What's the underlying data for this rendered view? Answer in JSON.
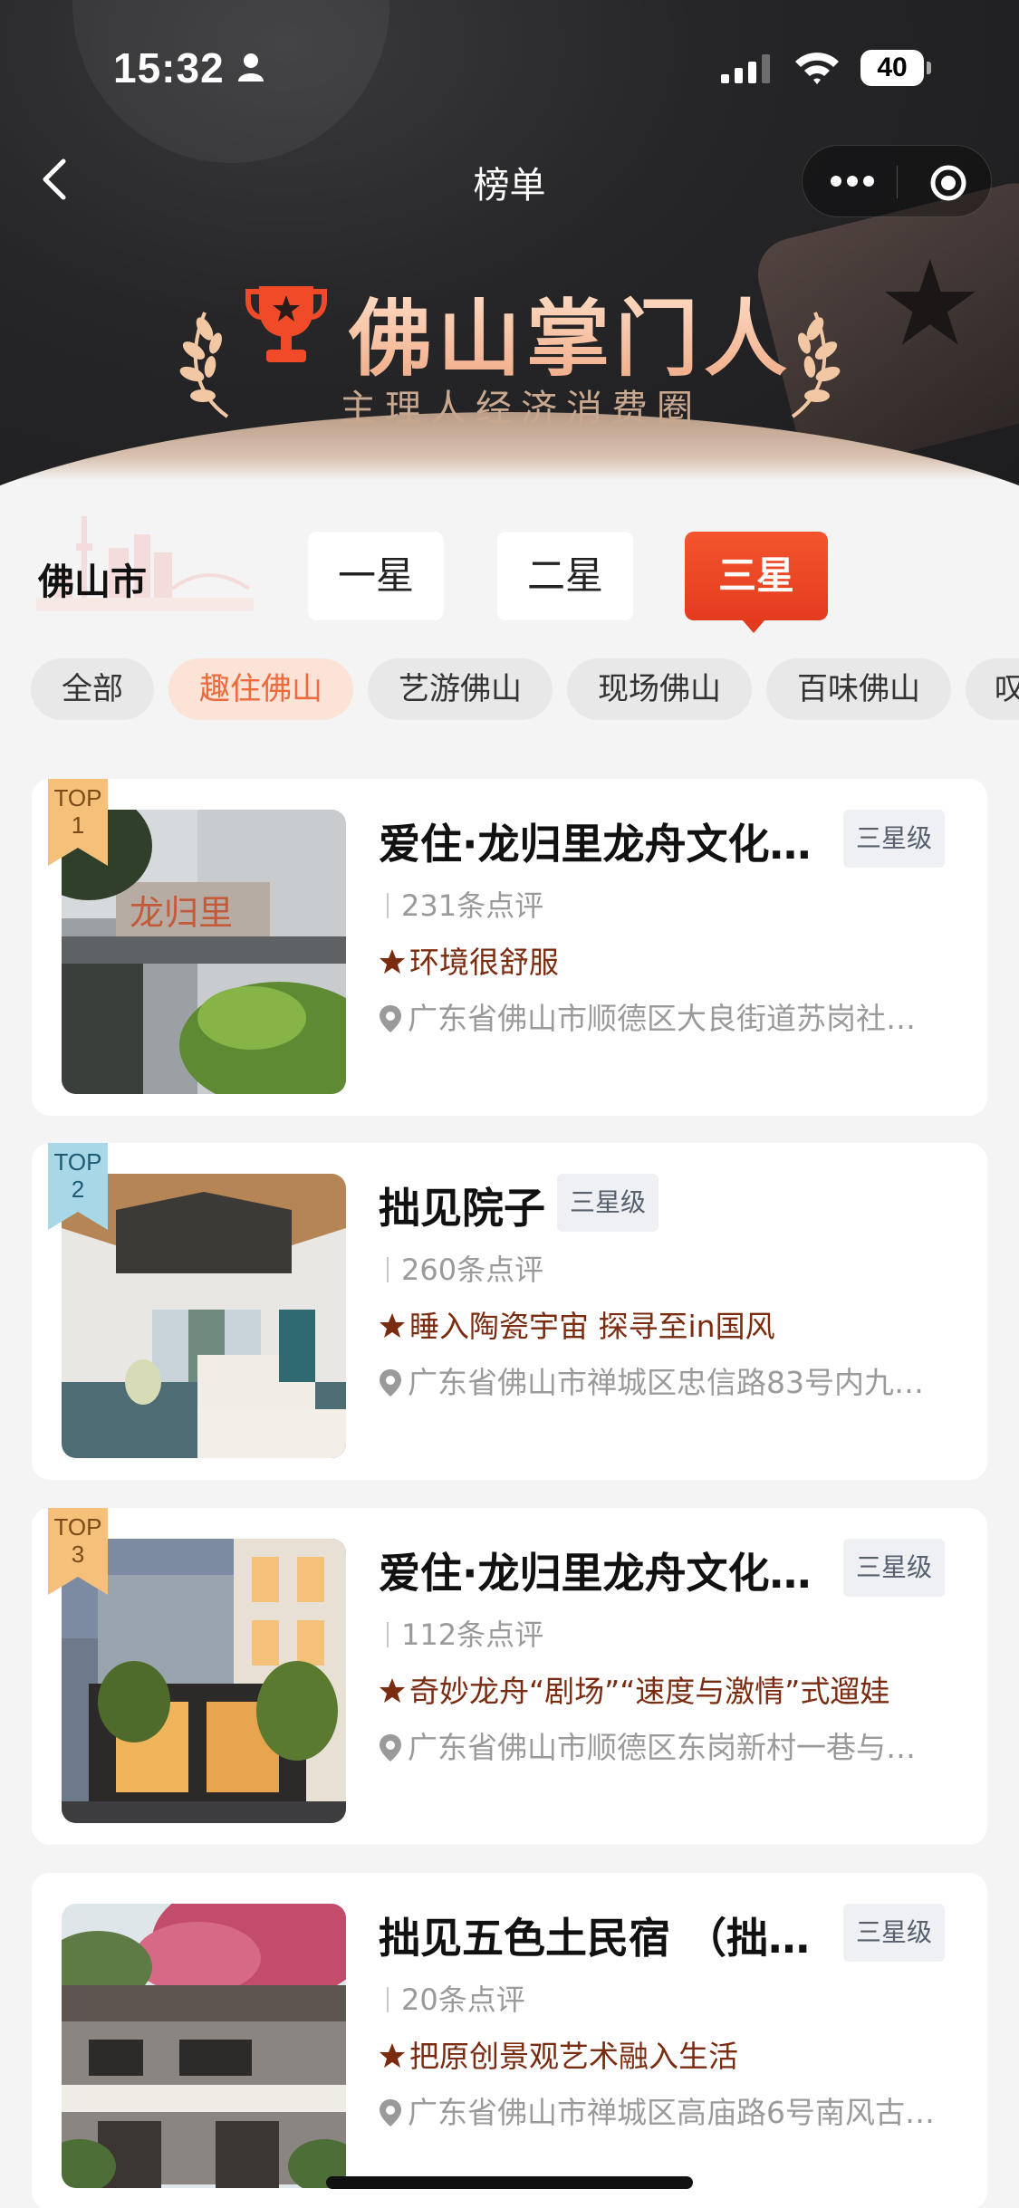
{
  "status_bar": {
    "time": "15:32",
    "battery": "40",
    "icons": [
      "person-icon",
      "signal-icon",
      "wifi-icon",
      "battery-icon"
    ]
  },
  "nav": {
    "title": "榜单",
    "icons": [
      "back-icon",
      "more-icon",
      "target-icon"
    ]
  },
  "hero": {
    "title": "佛山掌门人",
    "subtitle": "主理人经济消费圈",
    "icons": [
      "trophy-icon",
      "laurel-icon"
    ]
  },
  "city": "佛山市",
  "star_tabs": [
    {
      "label": "一星",
      "active": false
    },
    {
      "label": "二星",
      "active": false
    },
    {
      "label": "三星",
      "active": true
    }
  ],
  "categories": [
    {
      "label": "全部",
      "active": false
    },
    {
      "label": "趣住佛山",
      "active": true
    },
    {
      "label": "艺游佛山",
      "active": false
    },
    {
      "label": "现场佛山",
      "active": false
    },
    {
      "label": "百味佛山",
      "active": false
    },
    {
      "label": "叹",
      "active": false
    }
  ],
  "colors": {
    "accent": "#E8452A",
    "pill_active_bg": "#FBE3D7",
    "pill_active_text": "#EF6A3A",
    "highlight_text": "#7B2B10",
    "rank1": "#F5C07A",
    "rank2": "#A8D8E8",
    "rank3": "#F5C07A"
  },
  "listings": [
    {
      "rank_top": "TOP",
      "rank_num": "1",
      "title": "爱住·龙归里龙舟文化…",
      "badge": "三星级",
      "reviews": "231条点评",
      "highlight": "环境很舒服",
      "address": "广东省佛山市顺德区大良街道苏岗社…"
    },
    {
      "rank_top": "TOP",
      "rank_num": "2",
      "title": "拙见院子",
      "badge": "三星级",
      "reviews": "260条点评",
      "highlight": "睡入陶瓷宇宙 探寻至in国风",
      "address": "广东省佛山市禅城区忠信路83号内九…"
    },
    {
      "rank_top": "TOP",
      "rank_num": "3",
      "title": "爱住·龙归里龙舟文化…",
      "badge": "三星级",
      "reviews": "112条点评",
      "highlight": "奇妙龙舟“剧场”“速度与激情”式遛娃",
      "address": "广东省佛山市顺德区东岗新村一巷与…"
    },
    {
      "rank_top": "",
      "rank_num": "",
      "title": "拙见五色土民宿 （拙…",
      "badge": "三星级",
      "reviews": "20条点评",
      "highlight": "把原创景观艺术融入生活",
      "address": "广东省佛山市禅城区高庙路6号南风古…"
    }
  ]
}
